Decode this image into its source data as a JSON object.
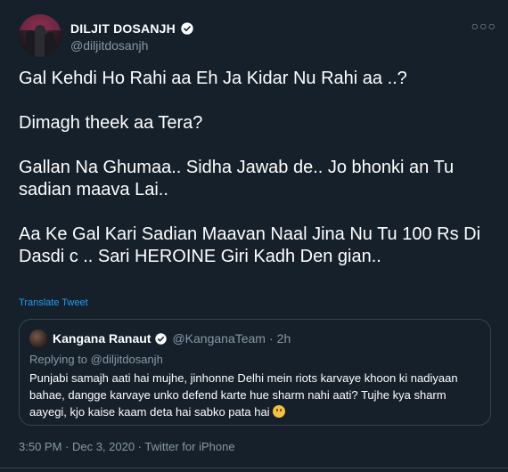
{
  "author": {
    "name": "DILJIT DOSANJH",
    "handle": "@diljitdosanjh",
    "verified": true
  },
  "menu_icon": "more-horizontal-icon",
  "tweet": {
    "lines": [
      "Gal Kehdi Ho Rahi aa Eh Ja Kidar Nu Rahi aa ..?",
      "Dimagh theek aa Tera?",
      "Gallan Na Ghumaa.. Sidha Jawab de.. Jo bhonki an Tu sadian maava Lai..",
      "Aa Ke Gal Kari Sadian Maavan Naal Jina Nu Tu 100 Rs Di Dasdi c .. Sari HEROINE Giri Kadh Den gian.."
    ],
    "translate_label": "Translate Tweet"
  },
  "quote": {
    "name": "Kangana Ranaut",
    "handle": "@KanganaTeam",
    "separator": "·",
    "time": "2h",
    "replying_prefix": "Replying to",
    "replying_to": "@diljitdosanjh",
    "text": "Punjabi samajh aati hai mujhe, jinhonne Delhi mein riots karvaye khoon ki nadiyaan bahae, dangge karvaye unko defend karte hue sharm nahi aati? Tujhe kya sharm aayegi, kjo kaise kaam deta hai sabko pata hai",
    "emoji": "smiling-face-icon"
  },
  "meta": {
    "text": "3:50 PM · Dec 3, 2020 · Twitter for iPhone"
  },
  "colors": {
    "background": "#15202b",
    "text": "#ffffff",
    "secondary": "#8899a6",
    "accent": "#1da1f2",
    "border": "#38444d"
  }
}
